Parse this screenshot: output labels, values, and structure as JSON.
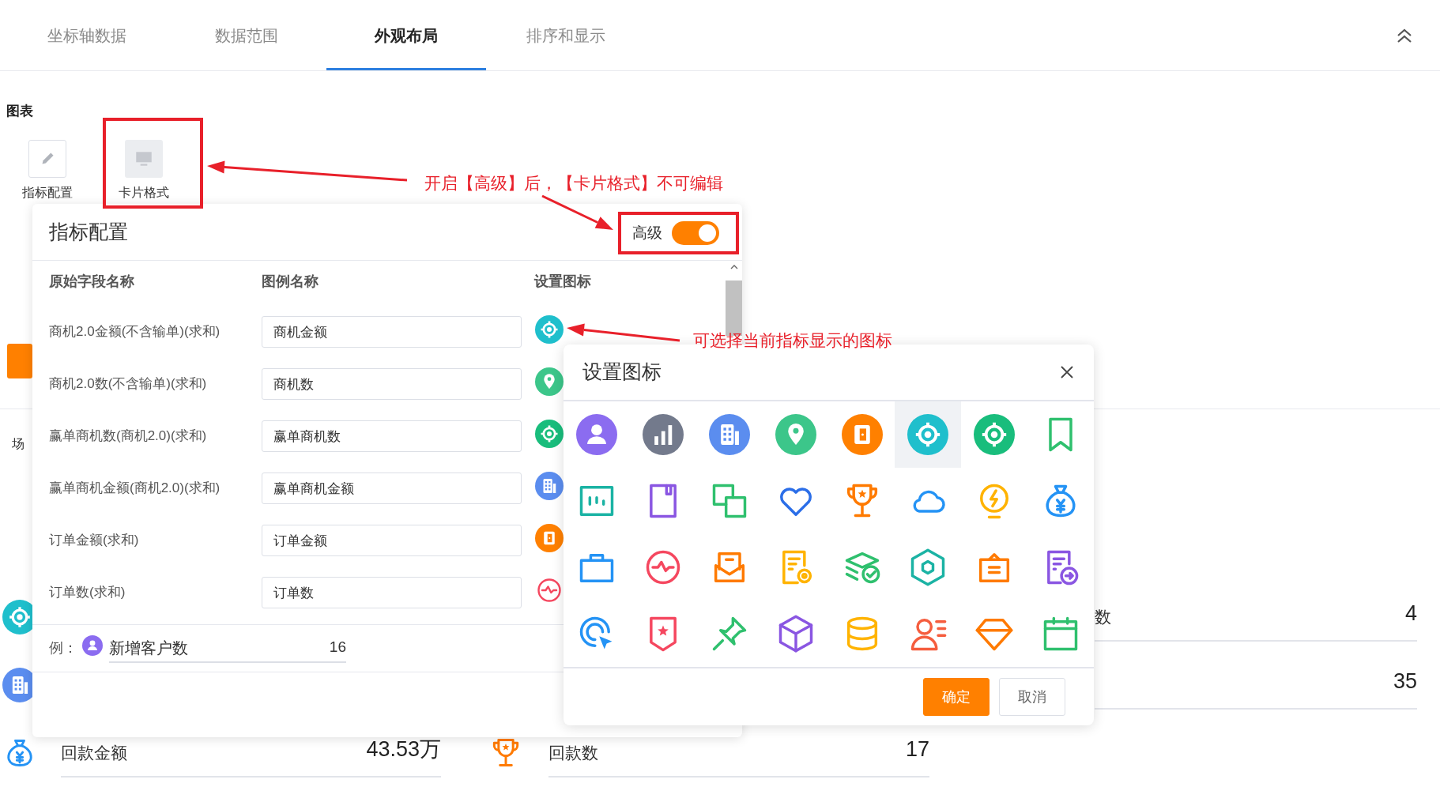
{
  "tabs": [
    {
      "label": "坐标轴数据",
      "selected": false
    },
    {
      "label": "数据范围",
      "selected": false
    },
    {
      "label": "外观布局",
      "selected": true
    },
    {
      "label": "排序和显示",
      "selected": false
    }
  ],
  "section_title": "图表",
  "chart_types": [
    {
      "label": "指标配置",
      "disabled": false
    },
    {
      "label": "卡片格式",
      "disabled": true
    }
  ],
  "scene_label": "场",
  "metric_rows": [
    {
      "right": {
        "label": "数",
        "value": "4"
      }
    },
    {
      "right": {
        "value": "35"
      }
    },
    {
      "left": {
        "label": "回款金额",
        "value": "43.53万"
      },
      "middle": {
        "label": "回款数",
        "value": "17"
      }
    }
  ],
  "metric_panel": {
    "title": "指标配置",
    "advanced": {
      "label": "高级",
      "on": true
    },
    "columns": [
      "原始字段名称",
      "图例名称",
      "设置图标"
    ],
    "rows": [
      {
        "field": "商机2.0金额(不含输单)(求和)",
        "legend": "商机金额"
      },
      {
        "field": "商机2.0数(不含输单)(求和)",
        "legend": "商机数"
      },
      {
        "field": "赢单商机数(商机2.0)(求和)",
        "legend": "赢单商机数"
      },
      {
        "field": "赢单商机金额(商机2.0)(求和)",
        "legend": "赢单商机金额"
      },
      {
        "field": "订单金额(求和)",
        "legend": "订单金额"
      },
      {
        "field": "订单数(求和)",
        "legend": "订单数"
      }
    ],
    "example": {
      "label": "例：",
      "name": "新增客户数",
      "value": "16"
    }
  },
  "icon_dialog": {
    "title": "设置图标",
    "icons": [
      {
        "selected": false
      },
      {
        "selected": false
      },
      {
        "selected": false
      },
      {
        "selected": false
      },
      {
        "selected": false
      },
      {
        "selected": true
      },
      {
        "selected": false
      },
      {
        "selected": false
      },
      {
        "selected": false
      },
      {
        "selected": false
      },
      {
        "selected": false
      },
      {
        "selected": false
      },
      {
        "selected": false
      },
      {
        "selected": false
      },
      {
        "selected": false
      },
      {
        "selected": false
      },
      {
        "selected": false
      },
      {
        "selected": false
      },
      {
        "selected": false
      },
      {
        "selected": false
      },
      {
        "selected": false
      },
      {
        "selected": false
      },
      {
        "selected": false
      },
      {
        "selected": false
      },
      {
        "selected": false
      },
      {
        "selected": false
      },
      {
        "selected": false
      },
      {
        "selected": false
      },
      {
        "selected": false
      },
      {
        "selected": false
      },
      {
        "selected": false
      },
      {
        "selected": false
      }
    ],
    "buttons": [
      {
        "label": "确定",
        "kind": "primary"
      },
      {
        "label": "取消",
        "kind": "default"
      }
    ]
  },
  "annotations": [
    {
      "text": "开启【高级】后，【卡片格式】不可编辑"
    },
    {
      "text": "可选择当前指标显示的图标"
    }
  ]
}
